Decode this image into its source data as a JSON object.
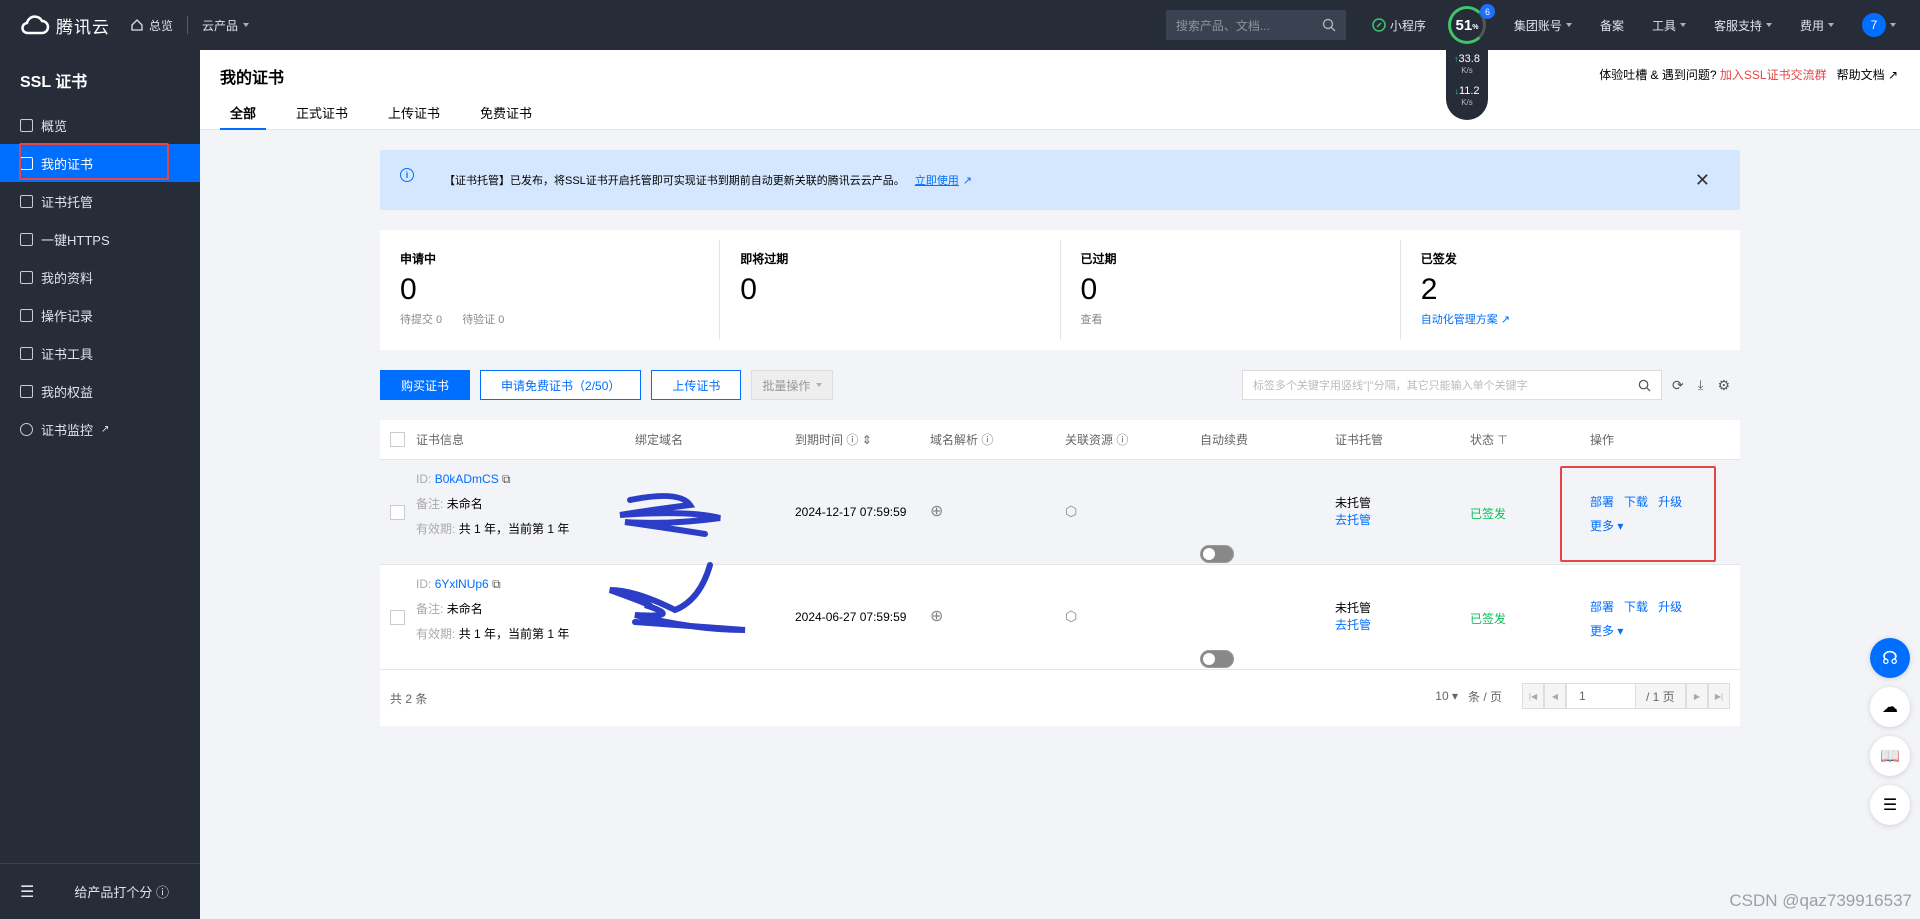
{
  "topbar": {
    "brand": "腾讯云",
    "nav": [
      "总览",
      "云产品"
    ],
    "search_placeholder": "搜索产品、文档...",
    "right_items": [
      "小程序",
      "集团账号",
      "备案",
      "工具",
      "客服支持",
      "费用"
    ],
    "avatar": "7",
    "speed": {
      "score": "51",
      "unit": "%",
      "badge": "6",
      "up": "33.8",
      "down": "11.2",
      "rate_unit": "K/s"
    }
  },
  "sidebar": {
    "title": "SSL 证书",
    "items": [
      {
        "label": "概览",
        "icon": "grid-icon"
      },
      {
        "label": "我的证书",
        "icon": "certificate-icon",
        "active": true
      },
      {
        "label": "证书托管",
        "icon": "hosting-icon"
      },
      {
        "label": "一键HTTPS",
        "icon": "sliders-icon"
      },
      {
        "label": "我的资料",
        "icon": "folder-icon"
      },
      {
        "label": "操作记录",
        "icon": "log-icon"
      },
      {
        "label": "证书工具",
        "icon": "tool-icon"
      },
      {
        "label": "我的权益",
        "icon": "gift-icon"
      },
      {
        "label": "证书监控",
        "icon": "monitor-icon"
      }
    ],
    "footer": "给产品打个分"
  },
  "header": {
    "title": "我的证书",
    "tabs": [
      "全部",
      "正式证书",
      "上传证书",
      "免费证书"
    ],
    "feedback": "体验吐槽 & 遇到问题?",
    "group_link": "加入SSL证书交流群",
    "help": "帮助文档"
  },
  "notice": {
    "text": "【证书托管】已发布，将SSL证书开启托管即可实现证书到期前自动更新关联的腾讯云云产品。",
    "link": "立即使用"
  },
  "stats": [
    {
      "label": "申请中",
      "value": "0",
      "sub": [
        "待提交 0",
        "待验证 0"
      ]
    },
    {
      "label": "即将过期",
      "value": "0",
      "sub": []
    },
    {
      "label": "已过期",
      "value": "0",
      "sub": [
        "查看"
      ]
    },
    {
      "label": "已签发",
      "value": "2",
      "sub": [
        "自动化管理方案"
      ]
    }
  ],
  "toolbar": {
    "buy": "购买证书",
    "apply_free": "申请免费证书（2/50）",
    "upload": "上传证书",
    "batch": "批量操作",
    "search_placeholder": "标签多个关键字用竖线\"|\"分隔，其它只能输入单个关键字"
  },
  "table": {
    "headers": [
      "证书信息",
      "绑定域名",
      "到期时间",
      "域名解析",
      "关联资源",
      "自动续费",
      "证书托管",
      "状态",
      "操作"
    ],
    "labels": {
      "id": "ID:",
      "remark": "备注:",
      "validity": "有效期:"
    },
    "rows": [
      {
        "id": "B0kADmCS",
        "remark": "未命名",
        "validity": "共 1 年，当前第 1 年",
        "expire": "2024-12-17 07:59:59",
        "hosting": "未托管",
        "hosting_link": "去托管",
        "status": "已签发",
        "actions": [
          "部署",
          "下载",
          "升级"
        ],
        "more": "更多"
      },
      {
        "id": "6YxlNUp6",
        "remark": "未命名",
        "validity": "共 1 年，当前第 1 年",
        "expire": "2024-06-27 07:59:59",
        "hosting": "未托管",
        "hosting_link": "去托管",
        "status": "已签发",
        "actions": [
          "部署",
          "下载",
          "升级"
        ],
        "more": "更多"
      }
    ],
    "total": "共 2 条",
    "page_size": "10",
    "page_size_unit": "条 / 页",
    "page": "1",
    "page_total": "/ 1 页"
  },
  "watermark": "CSDN @qaz739916537",
  "colors": {
    "accent": "#006eff",
    "sidebar": "#262c38",
    "success": "#0abf5b",
    "danger": "#e54545"
  }
}
